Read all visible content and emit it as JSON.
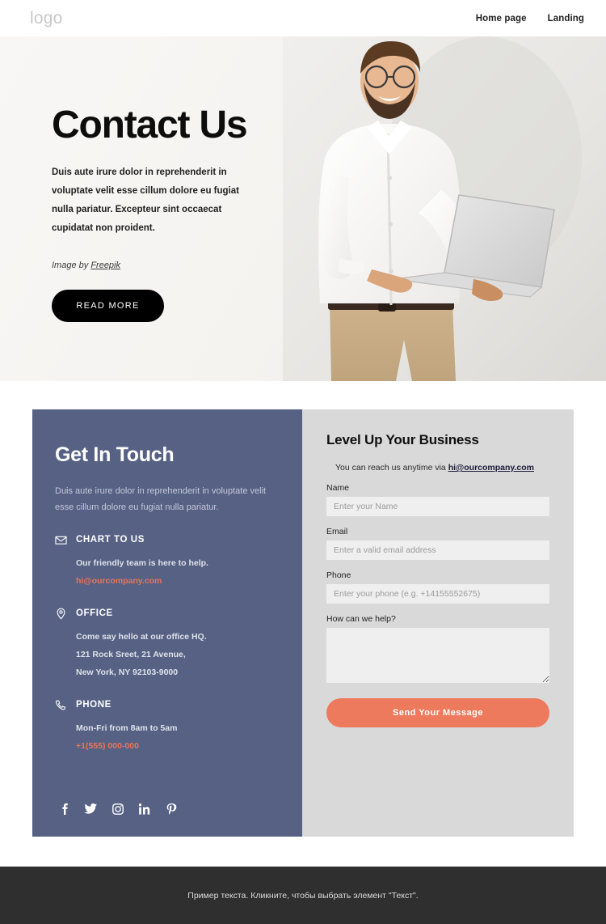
{
  "header": {
    "logo": "logo",
    "nav": [
      {
        "label": "Home page"
      },
      {
        "label": "Landing"
      }
    ]
  },
  "hero": {
    "title": "Contact Us",
    "paragraph": "Duis aute irure dolor in reprehenderit in voluptate velit esse cillum dolore eu fugiat nulla pariatur. Excepteur sint occaecat cupidatat non proident.",
    "credit_prefix": "Image by ",
    "credit_link": "Freepik",
    "button_label": "READ MORE",
    "image_alt": "Smiling bearded man with glasses in a white shirt holding a silver laptop"
  },
  "touch": {
    "title": "Get In Touch",
    "paragraph": "Duis aute irure dolor in reprehenderit in voluptate velit esse cillum dolore eu fugiat nulla pariatur.",
    "blocks": [
      {
        "icon": "envelope-icon",
        "label": "CHART TO US",
        "lines": [
          "Our friendly team is here to help."
        ],
        "accent": "hi@ourcompany.com"
      },
      {
        "icon": "map-pin-icon",
        "label": "OFFICE",
        "lines": [
          "Come say hello at our office HQ.",
          "121 Rock Sreet, 21 Avenue,",
          "New York, NY 92103-9000"
        ],
        "accent": ""
      },
      {
        "icon": "phone-icon",
        "label": "PHONE",
        "lines": [
          "Mon-Fri from 8am to 5am"
        ],
        "accent": "+1(555) 000-000"
      }
    ],
    "socials": [
      {
        "icon": "facebook-icon",
        "name": "Facebook"
      },
      {
        "icon": "twitter-icon",
        "name": "Twitter"
      },
      {
        "icon": "instagram-icon",
        "name": "Instagram"
      },
      {
        "icon": "linkedin-icon",
        "name": "LinkedIn"
      },
      {
        "icon": "pinterest-icon",
        "name": "Pinterest"
      }
    ]
  },
  "form": {
    "title": "Level Up Your Business",
    "subtitle_prefix": "You can reach us anytime via ",
    "subtitle_email": "hi@ourcompany.com",
    "fields": [
      {
        "label": "Name",
        "placeholder": "Enter your Name",
        "value": ""
      },
      {
        "label": "Email",
        "placeholder": "Enter a valid email address",
        "value": ""
      },
      {
        "label": "Phone",
        "placeholder": "Enter your phone (e.g. +14155552675)",
        "value": ""
      }
    ],
    "message_label": "How can we help?",
    "message_placeholder": "",
    "message_value": "",
    "submit_label": "Send Your Message"
  },
  "footer": {
    "text": "Пример текста. Кликните, чтобы выбрать элемент \"Текст\"."
  },
  "colors": {
    "panel_blue": "#566184",
    "accent_coral": "#ed7a5c",
    "form_bg": "#d9d9d9",
    "footer_bg": "#2f2f2f",
    "hero_bg": "#f7f6f4"
  }
}
